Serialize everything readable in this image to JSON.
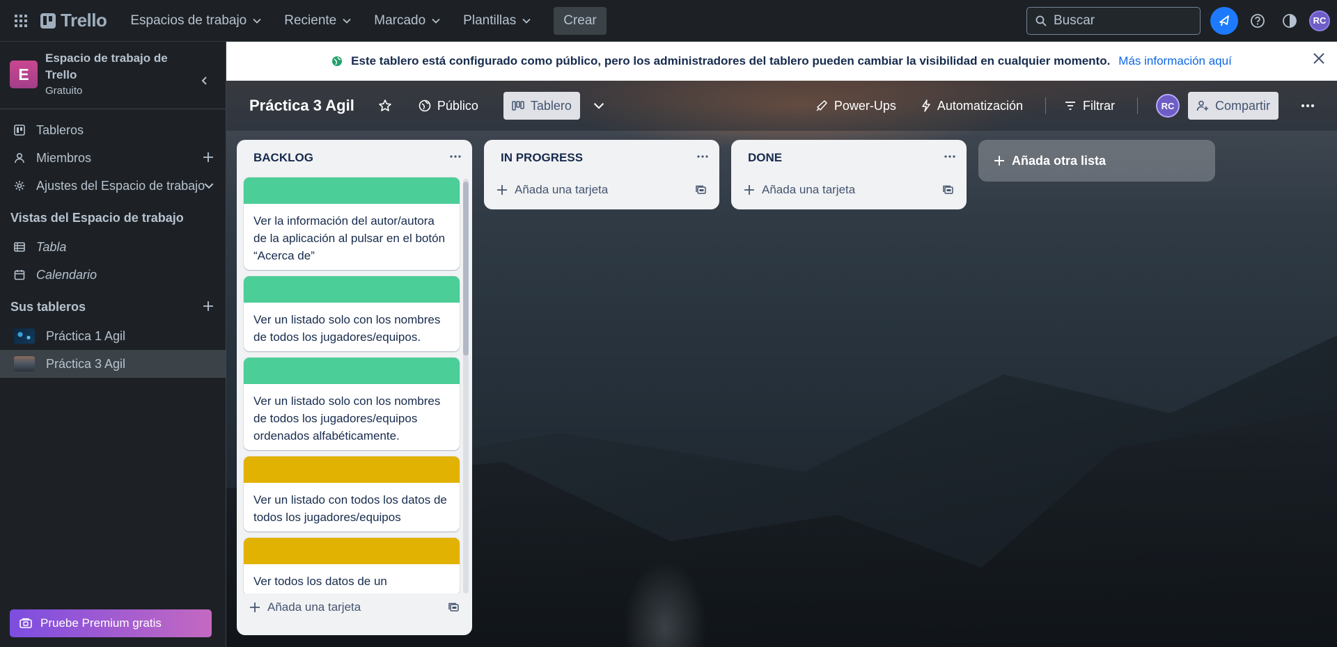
{
  "topbar": {
    "logo": "Trello",
    "nav": [
      "Espacios de trabajo",
      "Reciente",
      "Marcado",
      "Plantillas"
    ],
    "create": "Crear",
    "search_placeholder": "Buscar",
    "avatar": "RC"
  },
  "sidebar": {
    "workspace_name": "Espacio de trabajo de Trello",
    "workspace_initial": "E",
    "workspace_plan": "Gratuito",
    "menu": [
      "Tableros",
      "Miembros",
      "Ajustes del Espacio de trabajo"
    ],
    "views_title": "Vistas del Espacio de trabajo",
    "views": [
      "Tabla",
      "Calendario"
    ],
    "boards_title": "Sus tableros",
    "boards": [
      "Práctica 1 Agil",
      "Práctica 3 Agil"
    ],
    "premium": "Pruebe Premium gratis"
  },
  "banner": {
    "message": "Este tablero está configurado como público, pero los administradores del tablero pueden cambiar la visibilidad en cualquier momento.",
    "link": "Más información aquí"
  },
  "board": {
    "title": "Práctica 3 Agil",
    "visibility": "Público",
    "view": "Tablero",
    "powerups": "Power-Ups",
    "automation": "Automatización",
    "filter": "Filtrar",
    "member": "RC",
    "share": "Compartir"
  },
  "lists": [
    {
      "title": "BACKLOG",
      "cards": [
        {
          "cover": "#4bce97",
          "text": "Ver la información del autor/autora de la aplicación al pulsar en el botón “Acerca de”"
        },
        {
          "cover": "#4bce97",
          "text": "Ver un listado solo con los nombres de todos los jugadores/equipos."
        },
        {
          "cover": "#4bce97",
          "text": "Ver un listado solo con los nombres de todos los jugadores/equipos ordenados alfabéticamente."
        },
        {
          "cover": "#e2b203",
          "text": "Ver un listado con todos los datos de todos los jugadores/equipos"
        },
        {
          "cover": "#e2b203",
          "text": "Ver todos los datos de un"
        }
      ],
      "add_card": "Añada una tarjeta"
    },
    {
      "title": "IN PROGRESS",
      "cards": [],
      "add_card": "Añada una tarjeta"
    },
    {
      "title": "DONE",
      "cards": [],
      "add_card": "Añada una tarjeta"
    }
  ],
  "add_list": "Añada otra lista"
}
